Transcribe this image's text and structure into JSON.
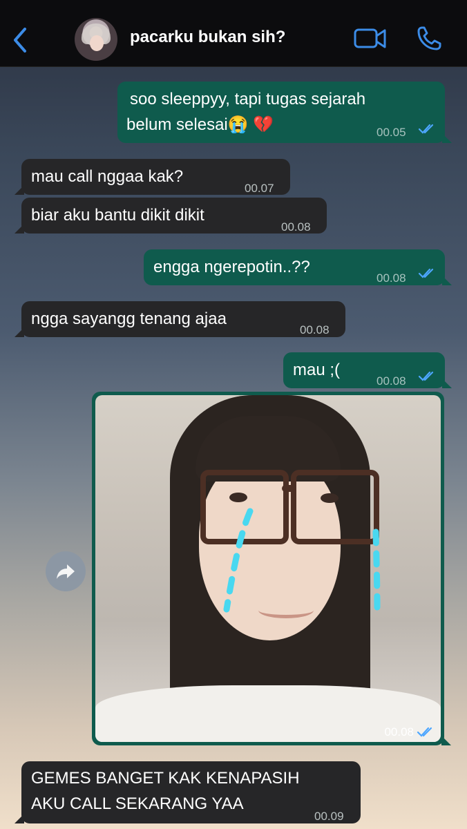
{
  "header": {
    "back_label": "back",
    "contact_name": "pacarku bukan sih?"
  },
  "messages": [
    {
      "direction": "out",
      "lines": [
        "soo sleeppyy, tapi tugas sejarah",
        "belum selesai😭 💔"
      ],
      "time": "00.05",
      "read": true
    },
    {
      "direction": "in",
      "lines": [
        "mau call nggaa kak?"
      ],
      "time": "00.07"
    },
    {
      "direction": "in",
      "lines": [
        "biar aku bantu dikit dikit"
      ],
      "time": "00.08"
    },
    {
      "direction": "out",
      "lines": [
        "engga ngerepotin..??"
      ],
      "time": "00.08",
      "read": true
    },
    {
      "direction": "in",
      "lines": [
        "ngga sayangg tenang ajaa"
      ],
      "time": "00.08"
    },
    {
      "direction": "out",
      "lines": [
        "mau ;("
      ],
      "time": "00.08",
      "read": true
    },
    {
      "direction": "out",
      "type": "image",
      "time": "00.08",
      "read": true
    },
    {
      "direction": "in",
      "lines": [
        "GEMES BANGET KAK KENAPASIH",
        "AKU CALL SEKARANG YAA"
      ],
      "time": "00.09"
    }
  ],
  "colors": {
    "outgoing_bubble": "#0f5b4d",
    "incoming_bubble": "#262628",
    "accent_blue": "#3c8ce7",
    "tear_cyan": "#49d8f0"
  },
  "icons": {
    "back": "chevron-left-icon",
    "video": "video-camera-icon",
    "phone": "phone-icon",
    "forward": "forward-arrow-icon",
    "read_receipt": "double-check-icon"
  }
}
